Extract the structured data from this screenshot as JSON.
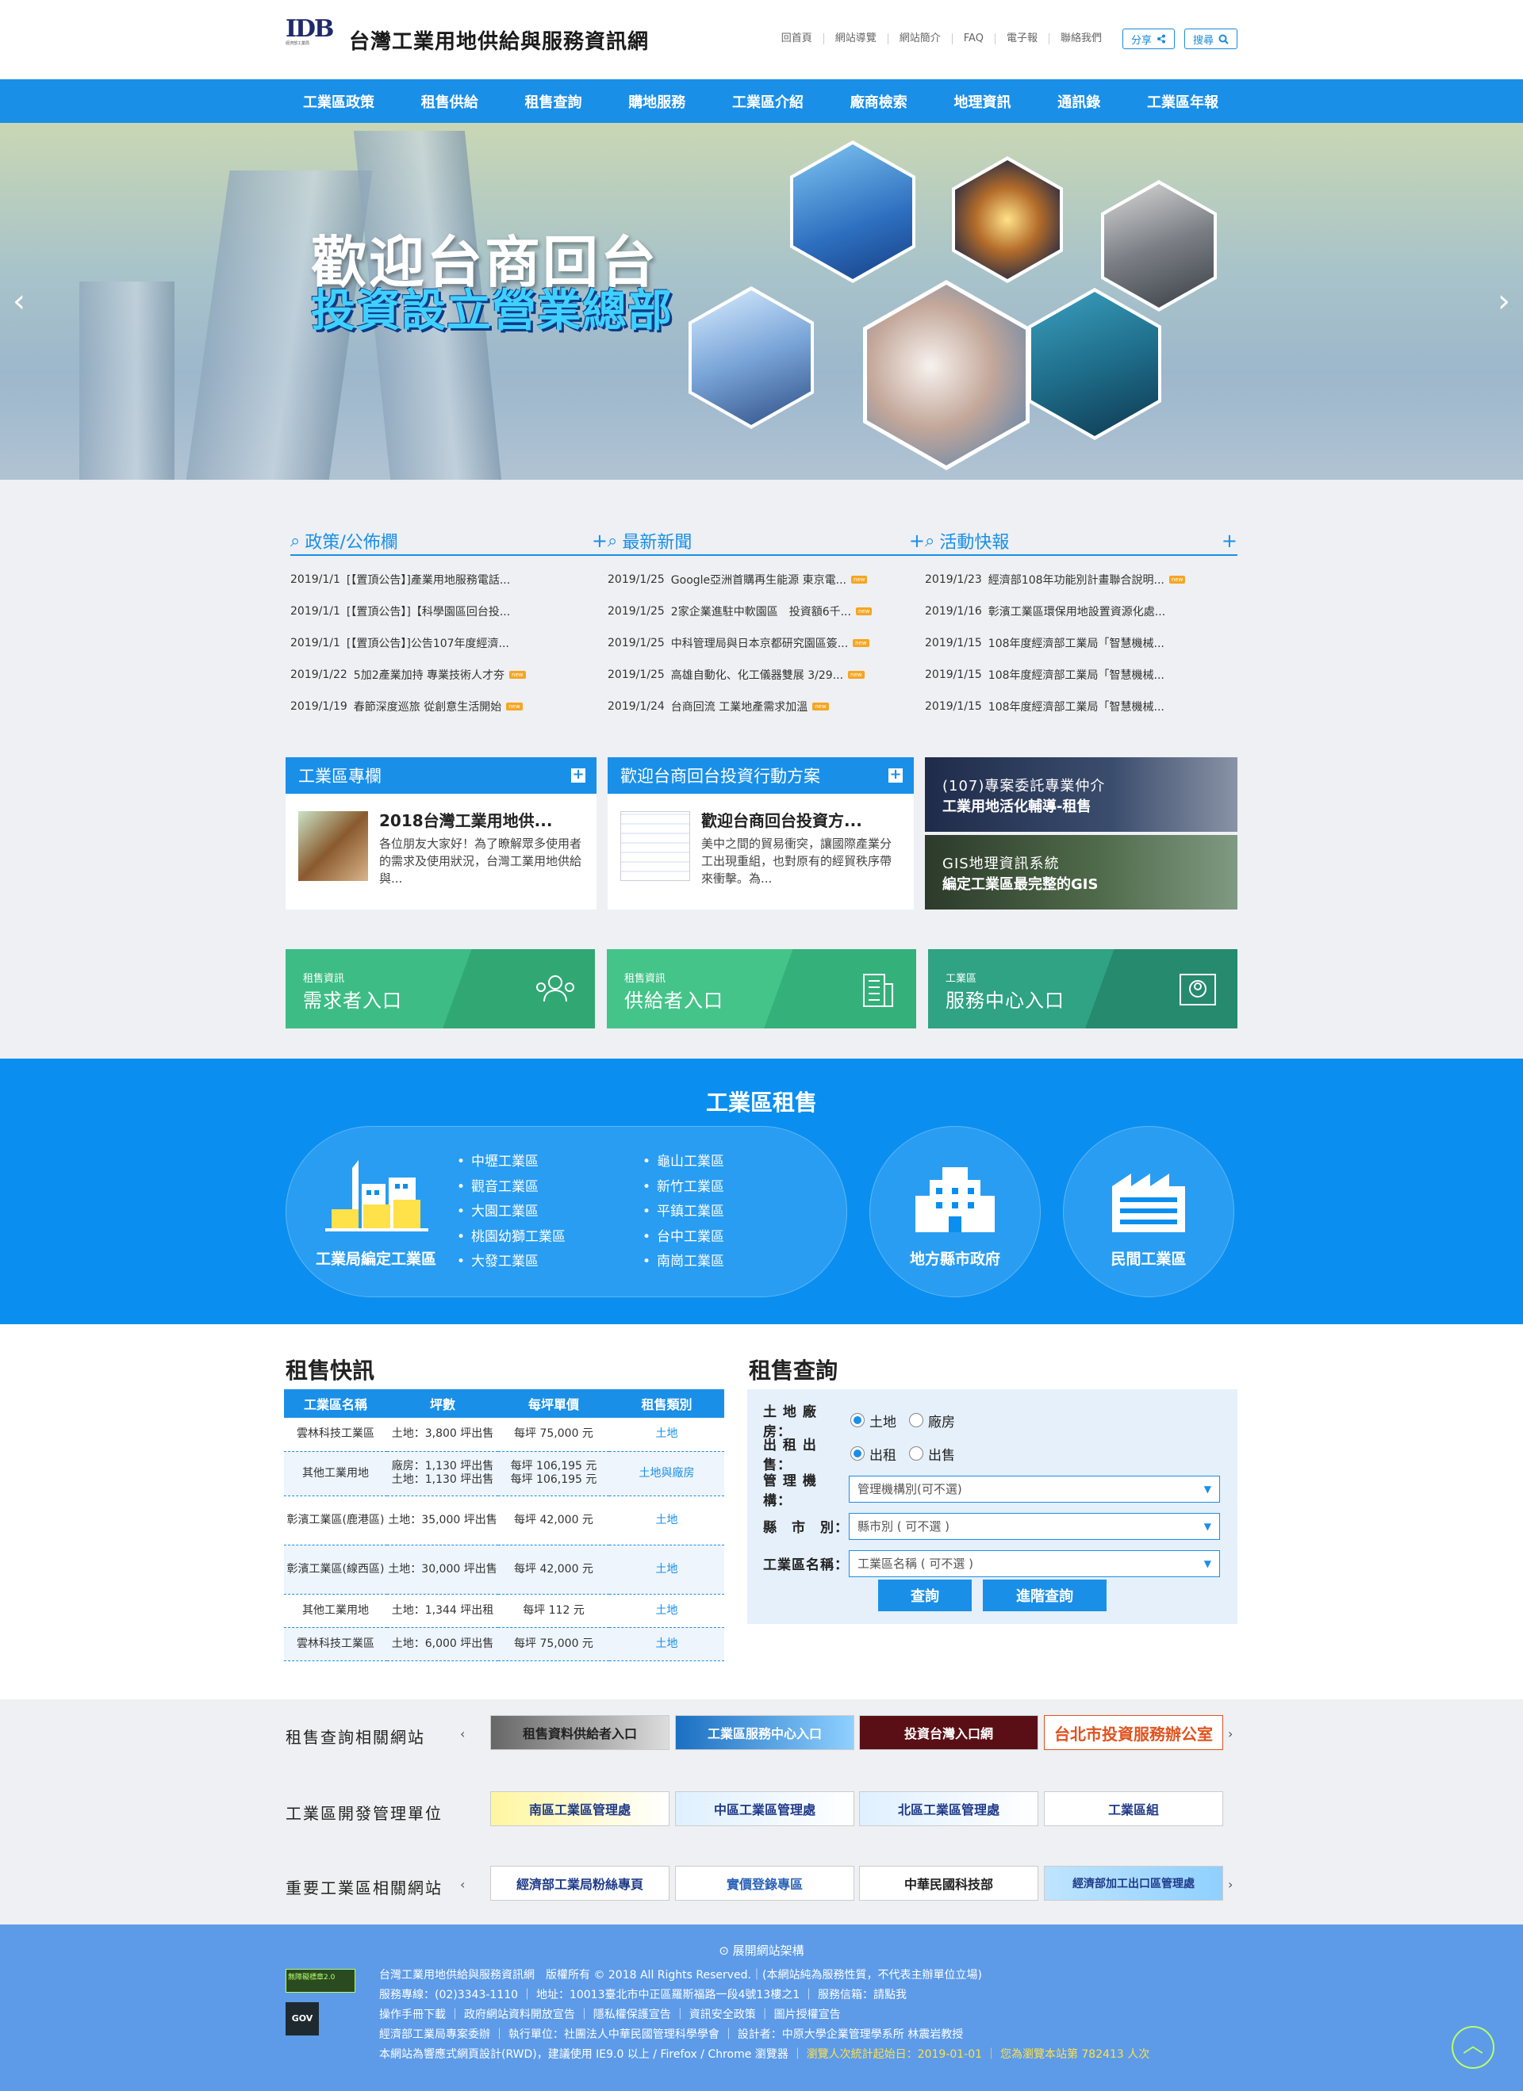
{
  "header": {
    "site_title": "台灣工業用地供給與服務資訊網",
    "logo_text": "IDB",
    "logo_sub": "經濟部工業局",
    "links": [
      "回首頁",
      "網站導覽",
      "網站簡介",
      "FAQ",
      "電子報",
      "聯絡我們"
    ],
    "share": "分享",
    "search": "搜尋"
  },
  "nav": [
    "工業區政策",
    "租售供給",
    "租售查詢",
    "購地服務",
    "工業區介紹",
    "廠商檢索",
    "地理資訊",
    "通訊錄",
    "工業區年報"
  ],
  "banner": {
    "line1": "歡迎台商回台",
    "line2": "投資設立營業總部"
  },
  "news": [
    {
      "title": "政策/公佈欄",
      "items": [
        {
          "date": "2019/1/1",
          "text": "[【置頂公告】]產業用地服務電話...",
          "new": false
        },
        {
          "date": "2019/1/1",
          "text": "[【置頂公告】]【科學園區回台投...",
          "new": false
        },
        {
          "date": "2019/1/1",
          "text": "[【置頂公告】]公告107年度經濟...",
          "new": false
        },
        {
          "date": "2019/1/22",
          "text": "5加2產業加持 專業技術人才夯",
          "new": true
        },
        {
          "date": "2019/1/19",
          "text": "春節深度巡旅 從創意生活開始",
          "new": true
        }
      ]
    },
    {
      "title": "最新新聞",
      "items": [
        {
          "date": "2019/1/25",
          "text": "Google亞洲首購再生能源 東京電...",
          "new": true
        },
        {
          "date": "2019/1/25",
          "text": "2家企業進駐中軟園區　投資額6千...",
          "new": true
        },
        {
          "date": "2019/1/25",
          "text": "中科管理局與日本京都研究園區簽...",
          "new": true
        },
        {
          "date": "2019/1/25",
          "text": "高雄自動化、化工儀器雙展 3/29...",
          "new": true
        },
        {
          "date": "2019/1/24",
          "text": "台商回流 工業地產需求加溫",
          "new": true
        }
      ]
    },
    {
      "title": "活動快報",
      "items": [
        {
          "date": "2019/1/23",
          "text": "經濟部108年功能別計畫聯合說明...",
          "new": true
        },
        {
          "date": "2019/1/16",
          "text": "彰濱工業區環保用地設置資源化處...",
          "new": false
        },
        {
          "date": "2019/1/15",
          "text": "108年度經濟部工業局「智慧機械...",
          "new": false
        },
        {
          "date": "2019/1/15",
          "text": "108年度經濟部工業局「智慧機械...",
          "new": false
        },
        {
          "date": "2019/1/15",
          "text": "108年度經濟部工業局「智慧機械...",
          "new": false
        }
      ]
    }
  ],
  "new_badge": "new",
  "cards": [
    {
      "header": "工業區專欄",
      "title": "2018台灣工業用地供...",
      "desc": "各位朋友大家好！為了瞭解眾多使用者的需求及使用狀況，台灣工業用地供給與..."
    },
    {
      "header": "歡迎台商回台投資行動方案",
      "title": "歡迎台商回台投資方...",
      "desc": "美中之間的貿易衝突，讓國際產業分工出現重組，也對原有的經貿秩序帶來衝擊。為..."
    }
  ],
  "promos": [
    {
      "a": "(107)專案委託專業仲介",
      "b": "工業用地活化輔導-租售"
    },
    {
      "a": "GIS地理資訊系統",
      "b": "編定工業區最完整的GIS"
    }
  ],
  "entries": [
    {
      "small": "租售資訊",
      "large": "需求者入口"
    },
    {
      "small": "租售資訊",
      "large": "供給者入口"
    },
    {
      "small": "工業區",
      "large": "服務中心入口"
    }
  ],
  "lease": {
    "title": "工業區租售",
    "main_label": "工業局編定工業區",
    "col1": [
      "中壢工業區",
      "觀音工業區",
      "大園工業區",
      "桃園幼獅工業區",
      "大發工業區"
    ],
    "col2": [
      "龜山工業區",
      "新竹工業區",
      "平鎮工業區",
      "台中工業區",
      "南崗工業區"
    ],
    "county": "地方縣市政府",
    "private": "民間工業區"
  },
  "flash": {
    "title": "租售快訊",
    "headers": [
      "工業區名稱",
      "坪數",
      "每坪單價",
      "租售類別"
    ],
    "rows": [
      [
        "雲林科技工業區",
        "土地：3,800 坪出售",
        "每坪 75,000 元",
        "土地"
      ],
      [
        "其他工業用地",
        "廠房：1,130 坪出售\n土地：1,130 坪出售",
        "每坪 106,195 元\n每坪 106,195 元",
        "土地與廠房"
      ],
      [
        "彰濱工業區(鹿港區)",
        "土地：35,000 坪出售",
        "每坪 42,000 元",
        "土地"
      ],
      [
        "彰濱工業區(線西區)",
        "土地：30,000 坪出售",
        "每坪 42,000 元",
        "土地"
      ],
      [
        "其他工業用地",
        "土地：1,344 坪出租",
        "每坪 112 元",
        "土地"
      ],
      [
        "雲林科技工業區",
        "土地：6,000 坪出售",
        "每坪 75,000 元",
        "土地"
      ]
    ]
  },
  "query": {
    "title": "租售查詢",
    "r1": {
      "label": "土 地 廠 房：",
      "o1": "土地",
      "o2": "廠房"
    },
    "r2": {
      "label": "出 租 出 售：",
      "o1": "出租",
      "o2": "出售"
    },
    "s1": {
      "label": "管 理 機 構：",
      "value": "管理機構別(可不選)"
    },
    "s2": {
      "label": "縣　市　別：",
      "value": "縣市別 ( 可不選 )"
    },
    "s3": {
      "label": "工業區名稱：",
      "value": "工業區名稱 ( 可不選 )"
    },
    "btn1": "查詢",
    "btn2": "進階查詢"
  },
  "related": {
    "rows": [
      {
        "label": "租售查詢相關網站",
        "logos": [
          "租售資料供給者入口",
          "工業區服務中心入口",
          "投資台灣入口網",
          "台北市投資服務辦公室"
        ]
      },
      {
        "label": "工業區開發管理單位",
        "logos": [
          "南區工業區管理處",
          "中區工業區管理處",
          "北區工業區管理處",
          "工業區組"
        ]
      },
      {
        "label": "重要工業區相關網站",
        "logos": [
          "經濟部工業局粉絲專頁",
          "實價登錄專區",
          "中華民國科技部",
          "經濟部加工出口區管理處"
        ]
      }
    ]
  },
  "footer": {
    "expand": "展開網站架構",
    "l1": "台灣工業用地供給與服務資訊網　版權所有 © 2018 All Rights Reserved.｜(本網站純為服務性質，不代表主辦單位立場)",
    "l2": "服務專線：(02)3343-1110 ｜ 地址：10013臺北市中正區羅斯福路一段4號13樓之1 ｜ 服務信箱：請點我",
    "l3": "操作手冊下載 ｜ 政府網站資料開放宣告 ｜ 隱私權保護宣告 ｜ 資訊安全政策 ｜ 圖片授權宣告",
    "l4": "經濟部工業局專案委辦 ｜ 執行單位：社團法人中華民國管理科學學會 ｜ 設計者：中原大學企業管理學系所 林震岩教授",
    "l5a": "本網站為響應式網頁設計(RWD)，建議使用 IE9.0 以上 / Firefox / Chrome 瀏覽器 ｜",
    "l5b": "瀏覽人次統計起始日：2019-01-01 ｜ 您為瀏覽本站第 782413 人次",
    "badge1": "無障礙標章2.0",
    "badge2": "GOV"
  },
  "colors": {
    "primary": "#1a8fe8",
    "lease_bg": "#0a8ff0",
    "footer_bg": "#5d9be8",
    "entry1": "#3fbf8a",
    "entry2": "#3fbf8a",
    "entry3": "#2a9b82"
  }
}
